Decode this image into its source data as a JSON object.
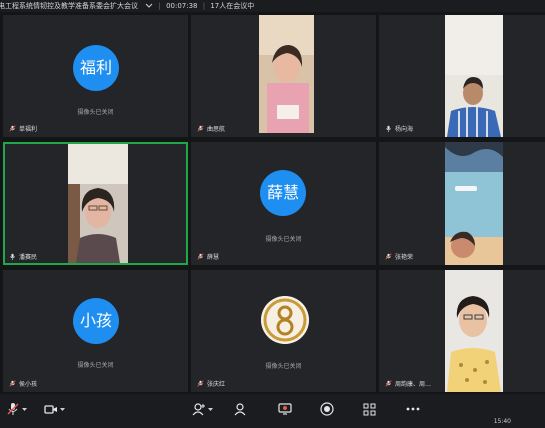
{
  "window": {
    "title": "电工程系统情韧控及教学准备系委会扩大会议",
    "elapsed": "00:07:38",
    "attendance": "17人在会议中"
  },
  "camera_off_text": "摄像头已关闭",
  "participants": [
    {
      "name": "单福利",
      "avatar_text": "福利",
      "video": false,
      "mic": "muted"
    },
    {
      "name": "曲思航",
      "video": true,
      "mic": "muted"
    },
    {
      "name": "杨向海",
      "video": true,
      "mic": "on"
    },
    {
      "name": "潘赛民",
      "video": true,
      "mic": "on",
      "active": true
    },
    {
      "name": "薛慧",
      "avatar_text": "薛慧",
      "video": false,
      "mic": "muted"
    },
    {
      "name": "张艳荣",
      "video": true,
      "mic": "muted"
    },
    {
      "name": "侯小孩",
      "avatar_text": "小孩",
      "video": false,
      "mic": "muted"
    },
    {
      "name": "张庆红",
      "video": false,
      "avatar_image": true,
      "mic": "muted"
    },
    {
      "name": "周韵康、周…",
      "video": true,
      "mic": "muted"
    }
  ],
  "clock": "15:40",
  "colors": {
    "avatar_blue": "#1f8ef1",
    "active_border": "#1fa84a",
    "tile_bg": "#242528",
    "app_bg": "#141517"
  },
  "toolbar_icons": [
    "microphone-icon",
    "camera-icon",
    "add-participant-icon",
    "participants-icon",
    "share-screen-icon",
    "record-icon",
    "apps-grid-icon",
    "more-icon"
  ]
}
